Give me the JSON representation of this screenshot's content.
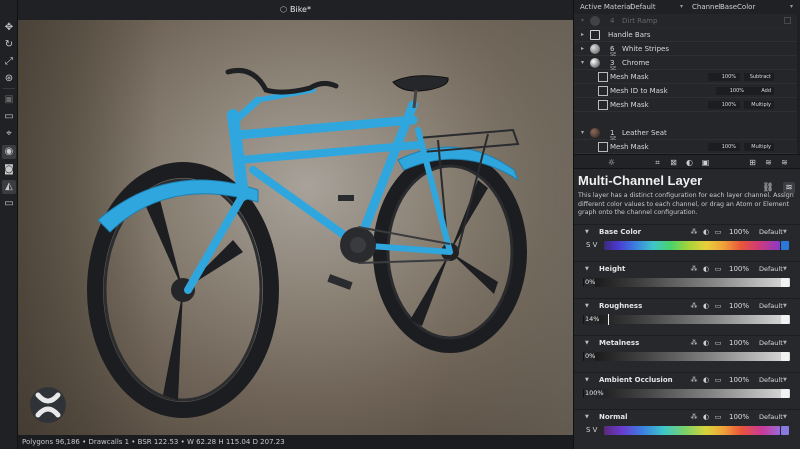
{
  "viewport": {
    "title": "Bike*",
    "status": "Polygons 96,186 • Drawcalls 1 • BSR 122.53 • W 62.28 H 115.04 D 207.23"
  },
  "toolbar_icons": [
    "move-icon",
    "rotate-icon",
    "scale-icon",
    "snap-icon",
    "save-icon",
    "clipboard-icon",
    "target-icon",
    "eye-icon",
    "camera-icon",
    "render-icon",
    "monitor-icon"
  ],
  "top_bar": {
    "active_material_label": "Active Material",
    "active_material_value": "Default",
    "channel_label": "Channel",
    "channel_value": "BaseColor"
  },
  "layers": [
    {
      "num": "4",
      "name": "Dirt Ramp",
      "type": "sphere",
      "faded": true
    },
    {
      "num": "",
      "name": "Handle Bars",
      "type": "folder"
    },
    {
      "num": "6",
      "name": "White Stripes",
      "type": "sphere",
      "sub": "SE"
    },
    {
      "num": "3",
      "name": "Chrome",
      "type": "sphere",
      "sub": "SE"
    },
    {
      "num": "",
      "name": "Mesh Mask",
      "type": "mask",
      "pct": "100%",
      "mode": "Subtract"
    },
    {
      "num": "",
      "name": "Mesh ID to Mask",
      "type": "mask",
      "pct": "100%",
      "mode": "Add"
    },
    {
      "num": "",
      "name": "Mesh Mask",
      "type": "mask",
      "pct": "100%",
      "mode": "Multiply"
    },
    {
      "num": "1",
      "name": "Leather Seat",
      "type": "sphere",
      "sub": "SE"
    },
    {
      "num": "",
      "name": "Mesh Mask",
      "type": "mask",
      "pct": "100%",
      "mode": "Multiply"
    }
  ],
  "panel": {
    "title": "Multi-Channel Layer",
    "description": "This layer has a distinct configuration for each layer channel. Assign different color values to each channel, or drag an Atom or Element graph onto the channel configuration."
  },
  "channels": [
    {
      "name": "Base Color",
      "pct": "100%",
      "mode": "Default",
      "kind": "color",
      "value": "S V"
    },
    {
      "name": "Height",
      "pct": "100%",
      "mode": "Default",
      "kind": "grey",
      "value": "0%"
    },
    {
      "name": "Roughness",
      "pct": "100%",
      "mode": "Default",
      "kind": "greyhi",
      "value": "14%"
    },
    {
      "name": "Metalness",
      "pct": "100%",
      "mode": "Default",
      "kind": "grey",
      "value": "0%"
    },
    {
      "name": "Ambient Occlusion",
      "pct": "100%",
      "mode": "Default",
      "kind": "white",
      "value": "100%"
    },
    {
      "name": "Normal",
      "pct": "100%",
      "mode": "Default",
      "kind": "normal",
      "value": "S V"
    }
  ],
  "colors": {
    "bike_frame": "#2fa7de",
    "tire": "#1e1f22",
    "accent_base_color_cap": "#2b78d8",
    "accent_normal_cap": "#8a7ae0"
  }
}
